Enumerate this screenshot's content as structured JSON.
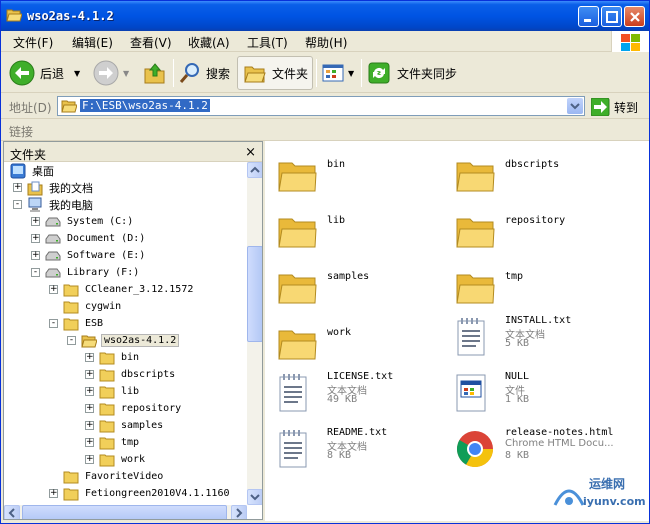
{
  "window": {
    "title": "wso2as-4.1.2"
  },
  "menu": [
    "文件(F)",
    "编辑(E)",
    "查看(V)",
    "收藏(A)",
    "工具(T)",
    "帮助(H)"
  ],
  "toolbar": {
    "back": "后退",
    "search": "搜索",
    "folders": "文件夹",
    "sync": "文件夹同步"
  },
  "address": {
    "label": "地址(D)",
    "value": "F:\\ESB\\wso2as-4.1.2",
    "go": "转到"
  },
  "links": {
    "label": "链接"
  },
  "folders_pane": {
    "title": "文件夹",
    "close": "×",
    "tree": [
      {
        "label": "桌面",
        "icon": "desktop-icon",
        "indent": 0,
        "exp": ""
      },
      {
        "label": "我的文档",
        "icon": "documents-icon",
        "indent": 1,
        "exp": "+"
      },
      {
        "label": "我的电脑",
        "icon": "computer-icon",
        "indent": 1,
        "exp": "-"
      },
      {
        "label": "System (C:)",
        "icon": "drive-icon",
        "indent": 2,
        "exp": "+"
      },
      {
        "label": "Document (D:)",
        "icon": "drive-icon",
        "indent": 2,
        "exp": "+"
      },
      {
        "label": "Software (E:)",
        "icon": "drive-icon",
        "indent": 2,
        "exp": "+"
      },
      {
        "label": "Library (F:)",
        "icon": "drive-icon",
        "indent": 2,
        "exp": "-"
      },
      {
        "label": "CCleaner_3.12.1572",
        "icon": "folder-icon",
        "indent": 3,
        "exp": "+"
      },
      {
        "label": "cygwin",
        "icon": "folder-icon",
        "indent": 3,
        "exp": ""
      },
      {
        "label": "ESB",
        "icon": "folder-icon",
        "indent": 3,
        "exp": "-"
      },
      {
        "label": "wso2as-4.1.2",
        "icon": "folder-open-icon",
        "indent": 4,
        "exp": "-",
        "selected": true
      },
      {
        "label": "bin",
        "icon": "folder-icon",
        "indent": 5,
        "exp": "+"
      },
      {
        "label": "dbscripts",
        "icon": "folder-icon",
        "indent": 5,
        "exp": "+"
      },
      {
        "label": "lib",
        "icon": "folder-icon",
        "indent": 5,
        "exp": "+"
      },
      {
        "label": "repository",
        "icon": "folder-icon",
        "indent": 5,
        "exp": "+"
      },
      {
        "label": "samples",
        "icon": "folder-icon",
        "indent": 5,
        "exp": "+"
      },
      {
        "label": "tmp",
        "icon": "folder-icon",
        "indent": 5,
        "exp": "+"
      },
      {
        "label": "work",
        "icon": "folder-icon",
        "indent": 5,
        "exp": "+"
      },
      {
        "label": "FavoriteVideo",
        "icon": "folder-icon",
        "indent": 3,
        "exp": ""
      },
      {
        "label": "Fetiongreen2010V4.1.1160",
        "icon": "folder-icon",
        "indent": 3,
        "exp": "+"
      }
    ]
  },
  "items": [
    {
      "name": "bin",
      "type": "folder"
    },
    {
      "name": "dbscripts",
      "type": "folder"
    },
    {
      "name": "lib",
      "type": "folder"
    },
    {
      "name": "repository",
      "type": "folder"
    },
    {
      "name": "samples",
      "type": "folder"
    },
    {
      "name": "tmp",
      "type": "folder"
    },
    {
      "name": "work",
      "type": "folder"
    },
    {
      "name": "INSTALL.txt",
      "type": "text",
      "kind": "文本文档",
      "size": "5 KB"
    },
    {
      "name": "LICENSE.txt",
      "type": "text",
      "kind": "文本文档",
      "size": "49 KB"
    },
    {
      "name": "NULL",
      "type": "null",
      "kind": "文件",
      "size": "1 KB"
    },
    {
      "name": "README.txt",
      "type": "text",
      "kind": "文本文档",
      "size": "8 KB"
    },
    {
      "name": "release-notes.html",
      "type": "chrome",
      "kind": "Chrome HTML Docu...",
      "size": "8 KB"
    }
  ],
  "watermark": {
    "line1": "运维网",
    "line2": "iyunv.com"
  }
}
